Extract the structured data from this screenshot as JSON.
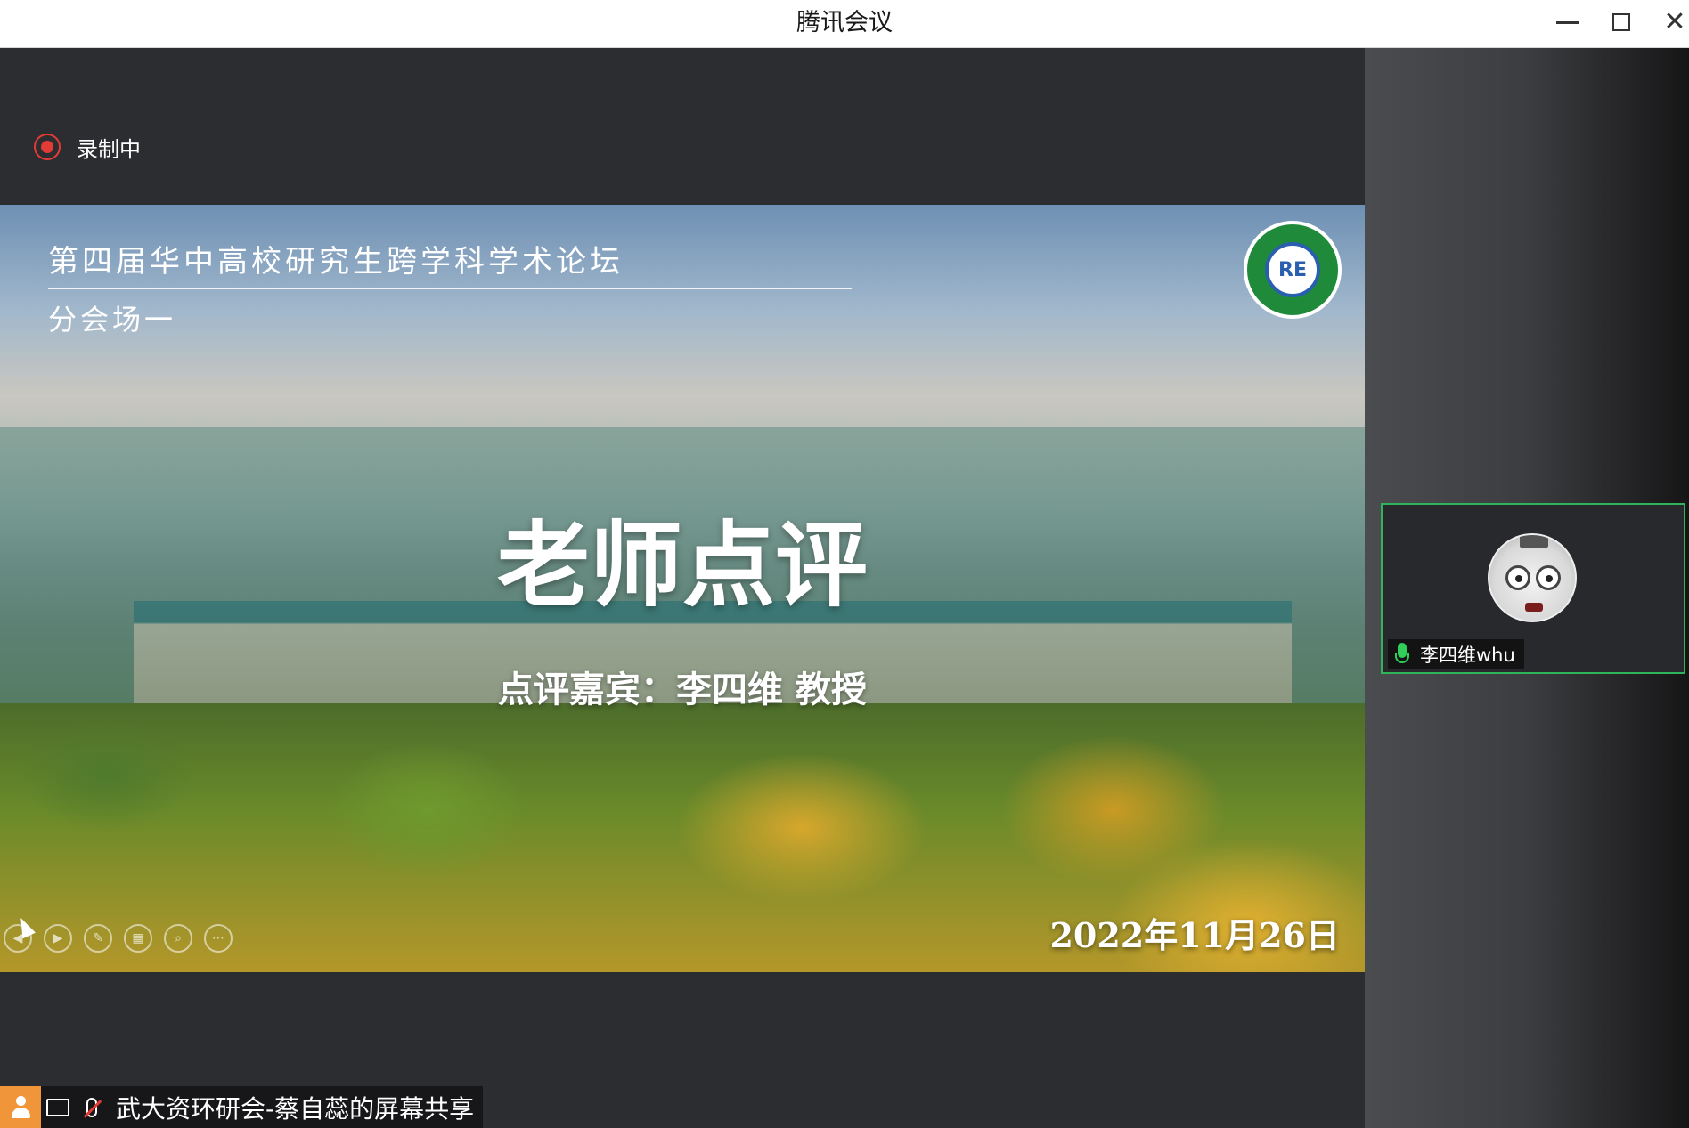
{
  "window": {
    "title": "腾讯会议",
    "minimize_icon": "minimize-icon",
    "maximize_icon": "maximize-icon",
    "close_icon": "close-icon",
    "close_glyph": "✕"
  },
  "recording": {
    "label": "录制中",
    "icon": "record-icon",
    "color": "#e23b36"
  },
  "slide": {
    "header": "第四届华中高校研究生跨学科学术论坛",
    "subheader": "分会场一",
    "logo_text": "RE",
    "title": "老师点评",
    "guest": "点评嘉宾：李四维 教授",
    "date": "2022年11月26日",
    "controls": [
      {
        "name": "prev-slide-icon",
        "glyph": "◀"
      },
      {
        "name": "next-slide-icon",
        "glyph": "▶"
      },
      {
        "name": "pen-icon",
        "glyph": "✎"
      },
      {
        "name": "slides-overview-icon",
        "glyph": "▦"
      },
      {
        "name": "zoom-icon",
        "glyph": "⌕"
      },
      {
        "name": "more-icon",
        "glyph": "⋯"
      }
    ]
  },
  "share_bar": {
    "label": "武大资环研会-蔡自蕊的屏幕共享",
    "accent": "#f0953a",
    "icons": [
      "person-icon",
      "screen-share-icon",
      "mic-muted-icon"
    ]
  },
  "participant": {
    "name": "李四维whu",
    "mic_color": "#2fcf5a",
    "active_border_color": "#2fb45a",
    "avatar": "cat-avatar"
  }
}
